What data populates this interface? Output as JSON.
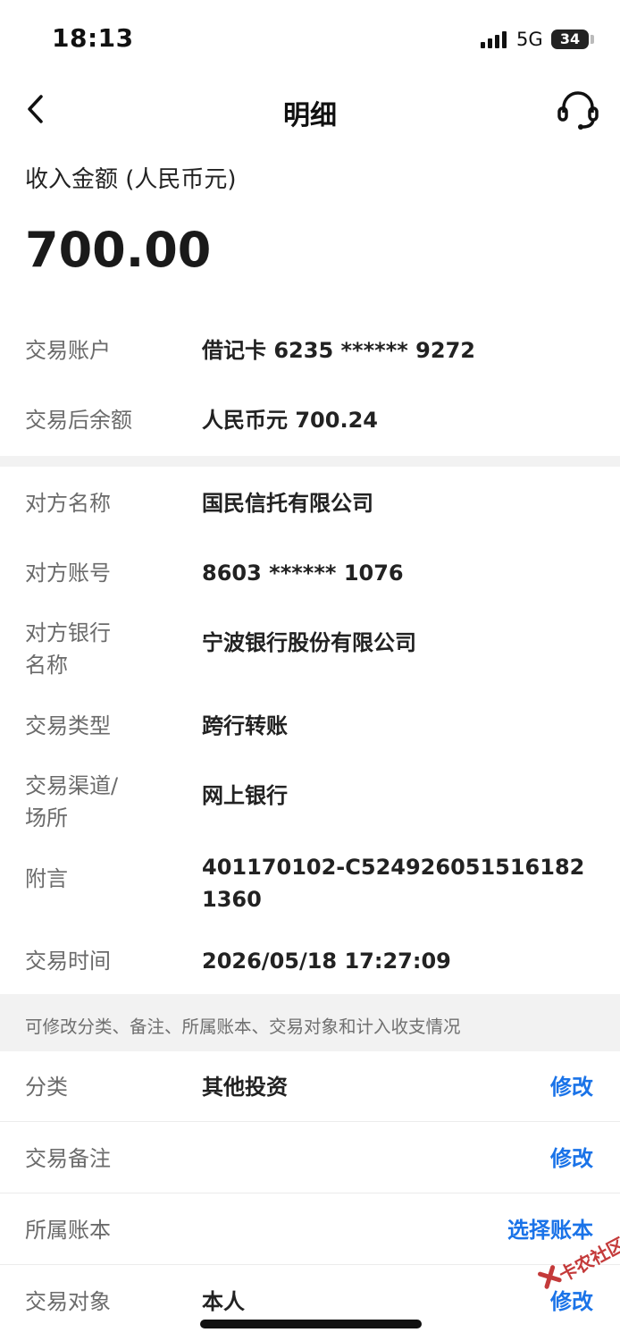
{
  "status_bar": {
    "time": "18:13",
    "network": "5G",
    "battery": "34"
  },
  "nav": {
    "title": "明细",
    "back_icon": "chevron-left-icon",
    "service_icon": "headset-icon"
  },
  "amount": {
    "label": "收入金额 (人民币元)",
    "value": "700.00"
  },
  "account_section": [
    {
      "label": "交易账户",
      "value": "借记卡 6235 ****** 9272"
    },
    {
      "label": "交易后余额",
      "value": "人民币元 700.24"
    }
  ],
  "detail_section": [
    {
      "label": "对方名称",
      "value": "国民信托有限公司"
    },
    {
      "label": "对方账号",
      "value": "8603 ****** 1076"
    },
    {
      "label": "对方银行名称",
      "value": "宁波银行股份有限公司"
    },
    {
      "label": "交易类型",
      "value": "跨行转账"
    },
    {
      "label": "交易渠道/场所",
      "value": "网上银行"
    },
    {
      "label": "附言",
      "value": "401170102-C5249260515161821360"
    },
    {
      "label": "交易时间",
      "value": "2026/05/18 17:27:09"
    }
  ],
  "hint": "可修改分类、备注、所属账本、交易对象和计入收支情况",
  "edit_section": [
    {
      "label": "分类",
      "value": "其他投资",
      "action": "修改"
    },
    {
      "label": "交易备注",
      "value": "",
      "action": "修改"
    },
    {
      "label": "所属账本",
      "value": "",
      "action": "选择账本"
    },
    {
      "label": "交易对象",
      "value": "本人",
      "action": "修改"
    }
  ],
  "watermark": "卡农社区",
  "colors": {
    "link": "#1a73e8",
    "label": "#6b6b6b",
    "band": "#f2f2f2"
  }
}
